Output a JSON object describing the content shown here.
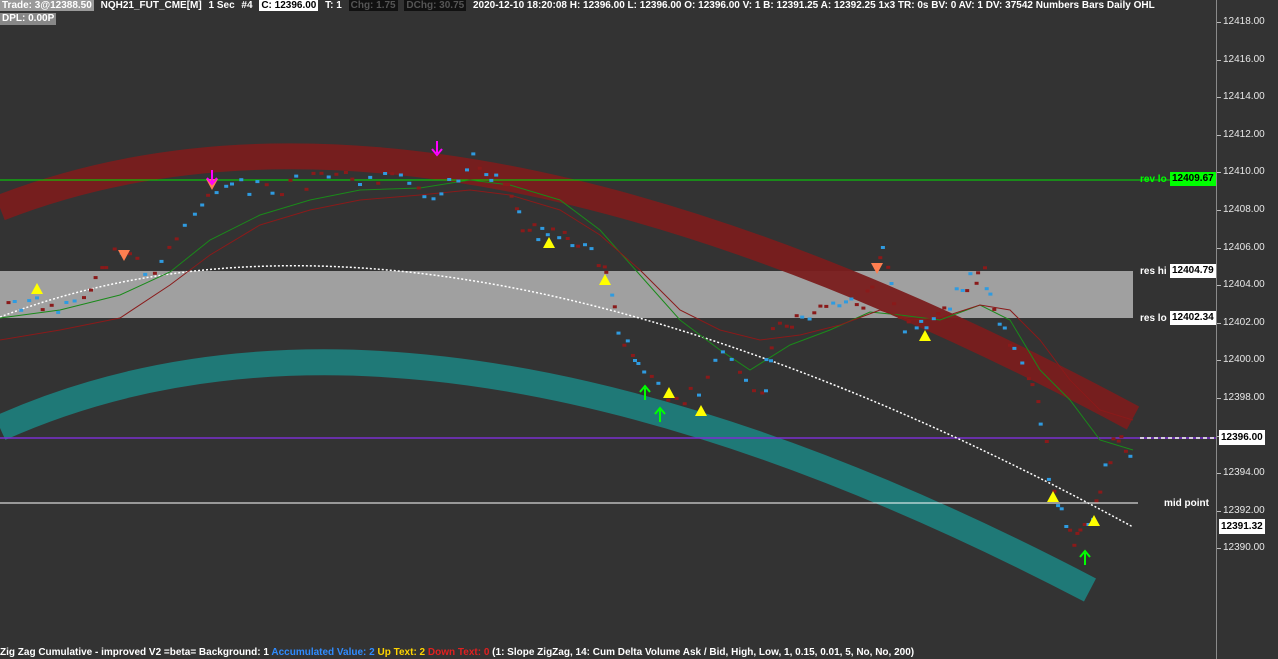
{
  "header": {
    "trade": "Trade: 3@12388.50",
    "symbol": "NQH21_FUT_CME[M]",
    "interval": "1 Sec",
    "chart_num": "#4",
    "close": "C: 12396.00",
    "t": "T: 1",
    "chg": "Chg: 1.75",
    "dchg": "DChg: 30.75",
    "info": "2020-12-10 18:20:08 H: 12396.00 L: 12396.00 O: 12396.00 V: 1 B: 12391.25 A: 12392.25 1x3 TR: 0s BV: 0 AV: 1 DV: 37542 Numbers Bars  Daily OHL",
    "dpl": "DPL: 0.00P"
  },
  "price_axis": {
    "ticks": [
      "12418.00",
      "12416.00",
      "12414.00",
      "12412.00",
      "12410.00",
      "12408.00",
      "12406.00",
      "12404.00",
      "12402.00",
      "12400.00",
      "12398.00",
      "12396.00",
      "12394.00",
      "12392.00",
      "12390.00"
    ],
    "current_price": "12396.00",
    "last_value": "12391.32"
  },
  "levels": {
    "rev_lo": {
      "label": "rev lo",
      "value": "12409.67",
      "color": "#00ff00"
    },
    "res_hi": {
      "label": "res hi",
      "value": "12404.79"
    },
    "res_lo": {
      "label": "res lo",
      "value": "12402.34"
    },
    "mid_point": {
      "label": "mid point"
    }
  },
  "footer": {
    "study": "Zig Zag Cumulative - improved V2 =beta=  Background: 1 ",
    "accumulated": "Accumulated Value: 2 ",
    "up_text": "Up Text: 2 ",
    "down_text": "Down Text: 0 ",
    "params": " (1: Slope ZigZag, 14: Cum Delta Volume Ask / Bid, High, Low, 1, 0.15, 0.01, 5, No, No, 200)"
  },
  "colors": {
    "background": "#333333",
    "upper_band": "#7a1e1e",
    "lower_band": "#1e7a78",
    "resistance_zone": "#a0a0a0",
    "rev_lo_line": "#00e000",
    "purple_line": "#7a2fd0",
    "mid_line": "#ffffff",
    "bar_up": "#2f9be0",
    "bar_down": "#8a1a1a",
    "signal_up": "#ffff00",
    "signal_down": "#ff7f50",
    "arrow_magenta": "#ff00ff",
    "arrow_green": "#00ff00"
  },
  "icons": {
    "arrow_down": "magenta-down-arrow-icon",
    "arrow_up": "green-up-arrow-icon",
    "triangle_up": "yellow-up-triangle-icon",
    "triangle_down": "orange-down-triangle-icon"
  }
}
